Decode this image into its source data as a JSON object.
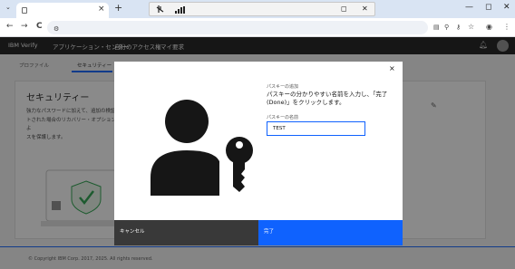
{
  "browser": {
    "new_tab": "+",
    "tab_close": "×",
    "tab_menu": "⌄",
    "win_min": "—",
    "win_max": "◻",
    "win_close": "✕",
    "back": "←",
    "forward": "→",
    "reload": "C"
  },
  "share_bar": {
    "restore": "◻",
    "close": "✕"
  },
  "app": {
    "brand": "IBM Verify",
    "nav": [
      "アプリケーション・センター",
      "自分のアクセス権",
      "マイ要求"
    ],
    "subnav": [
      "プロファイル",
      "セキュリティー"
    ]
  },
  "page": {
    "title": "セキュリティー",
    "description": "強力なパスワードに加えて、追加の検証\nトされた場合のリカバリー・オプションによ\nスを保護します。",
    "footer": "© Copyright IBM Corp. 2017, 2025. All rights reserved."
  },
  "modal": {
    "label": "パスキーの追加",
    "heading": "パスキーの分かりやすい名前を入力し、「完了 (Done)」をクリックします。",
    "field_label": "パスキーの名前",
    "field_value": "TEST",
    "cancel": "キャンセル",
    "done": "完了",
    "close": "×"
  },
  "colors": {
    "primary": "#0f62fe",
    "secondary_button": "#393939",
    "header": "#161616"
  }
}
